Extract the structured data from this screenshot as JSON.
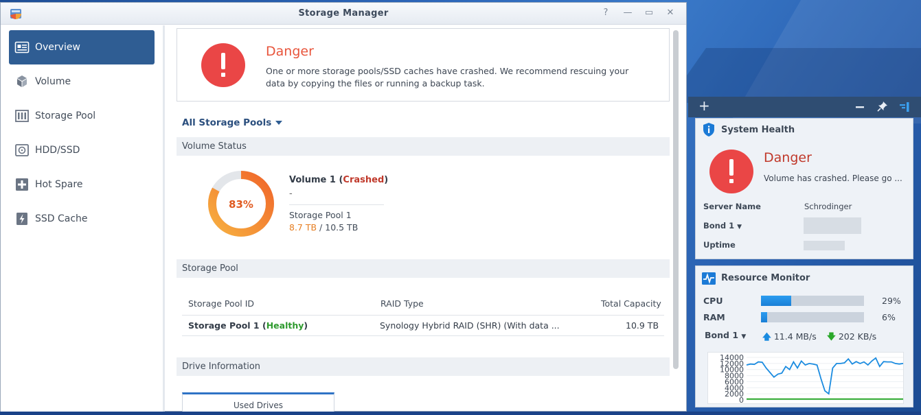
{
  "window": {
    "title": "Storage Manager",
    "help_icon": "?",
    "minimize_icon": "—",
    "maximize_icon": "▭",
    "close_icon": "✕"
  },
  "sidebar": {
    "items": [
      {
        "label": "Overview",
        "icon": "overview-icon",
        "active": true
      },
      {
        "label": "Volume",
        "icon": "volume-icon"
      },
      {
        "label": "Storage Pool",
        "icon": "storage-pool-icon"
      },
      {
        "label": "HDD/SSD",
        "icon": "hdd-icon"
      },
      {
        "label": "Hot Spare",
        "icon": "hot-spare-icon"
      },
      {
        "label": "SSD Cache",
        "icon": "ssd-cache-icon"
      }
    ]
  },
  "alert": {
    "title": "Danger",
    "message": "One or more storage pools/SSD caches have crashed. We recommend rescuing your data by copying the files or running a backup task."
  },
  "pool_filter": {
    "label": "All Storage Pools"
  },
  "volume_status": {
    "heading": "Volume Status",
    "percent": 83,
    "percent_label": "83%",
    "name": "Volume 1",
    "status": "Crashed",
    "description": "-",
    "pool": "Storage Pool 1",
    "used": "8.7 TB",
    "sep": " / ",
    "total": "10.5 TB"
  },
  "storage_pool": {
    "heading": "Storage Pool",
    "columns": [
      "Storage Pool ID",
      "RAID Type",
      "Total Capacity"
    ],
    "rows": [
      {
        "id": "Storage Pool 1",
        "status": "Healthy",
        "raid": "Synology Hybrid RAID (SHR) (With data ...",
        "capacity": "10.9 TB"
      }
    ]
  },
  "drive_info": {
    "heading": "Drive Information",
    "tab": "Used Drives"
  },
  "widgets": {
    "add_icon": "+",
    "system_health": {
      "title": "System Health",
      "status_title": "Danger",
      "status_text": "Volume has crashed. Please go ...",
      "server_name_label": "Server Name",
      "server_name": "Schrodinger",
      "bond_label": "Bond 1",
      "uptime_label": "Uptime"
    },
    "resource_monitor": {
      "title": "Resource Monitor",
      "cpu_label": "CPU",
      "cpu_percent": 29,
      "cpu_text": "29%",
      "ram_label": "RAM",
      "ram_percent": 6,
      "ram_text": "6%",
      "bond_label": "Bond 1",
      "upload": "11.4 MB/s",
      "download": "202 KB/s",
      "colors": {
        "upload": "#1a8be0",
        "download": "#2aa82a"
      }
    }
  },
  "chart_data": {
    "type": "line",
    "yticks": [
      "14000",
      "12000",
      "10000",
      "8000",
      "6000",
      "4000",
      "2000",
      "0"
    ],
    "ylim": [
      0,
      14000
    ],
    "x": [
      0,
      1,
      2,
      3,
      4,
      5,
      6,
      7,
      8,
      9,
      10,
      11,
      12,
      13,
      14,
      15,
      16,
      17,
      18,
      19,
      20,
      21,
      22,
      23,
      24,
      25,
      26,
      27,
      28,
      29,
      30,
      31,
      32,
      33,
      34,
      35,
      36,
      37,
      38,
      39,
      40
    ],
    "series": [
      {
        "values": [
          11500,
          11800,
          11700,
          12500,
          12400,
          10500,
          9000,
          7500,
          8500,
          8800,
          11000,
          10000,
          12500,
          10500,
          12800,
          11500,
          12000,
          11800,
          11500,
          7000,
          3000,
          2000,
          10500,
          12000,
          12000,
          12200,
          13500,
          11800,
          12600,
          12000,
          12500,
          11500,
          12800,
          13800,
          11000,
          12600,
          12500,
          12500,
          12000,
          11800,
          12000
        ],
        "color": "#1a8be0"
      },
      {
        "values": [
          300,
          300,
          300,
          300,
          300,
          300,
          300,
          300,
          300,
          300,
          300,
          300,
          300,
          300,
          300,
          300,
          300,
          300,
          300,
          300,
          300,
          300,
          300,
          300,
          300,
          300,
          300,
          300,
          300,
          300,
          300,
          300,
          300,
          300,
          300,
          300,
          300,
          300,
          300,
          300,
          300
        ],
        "color": "#2aa82a"
      }
    ]
  }
}
